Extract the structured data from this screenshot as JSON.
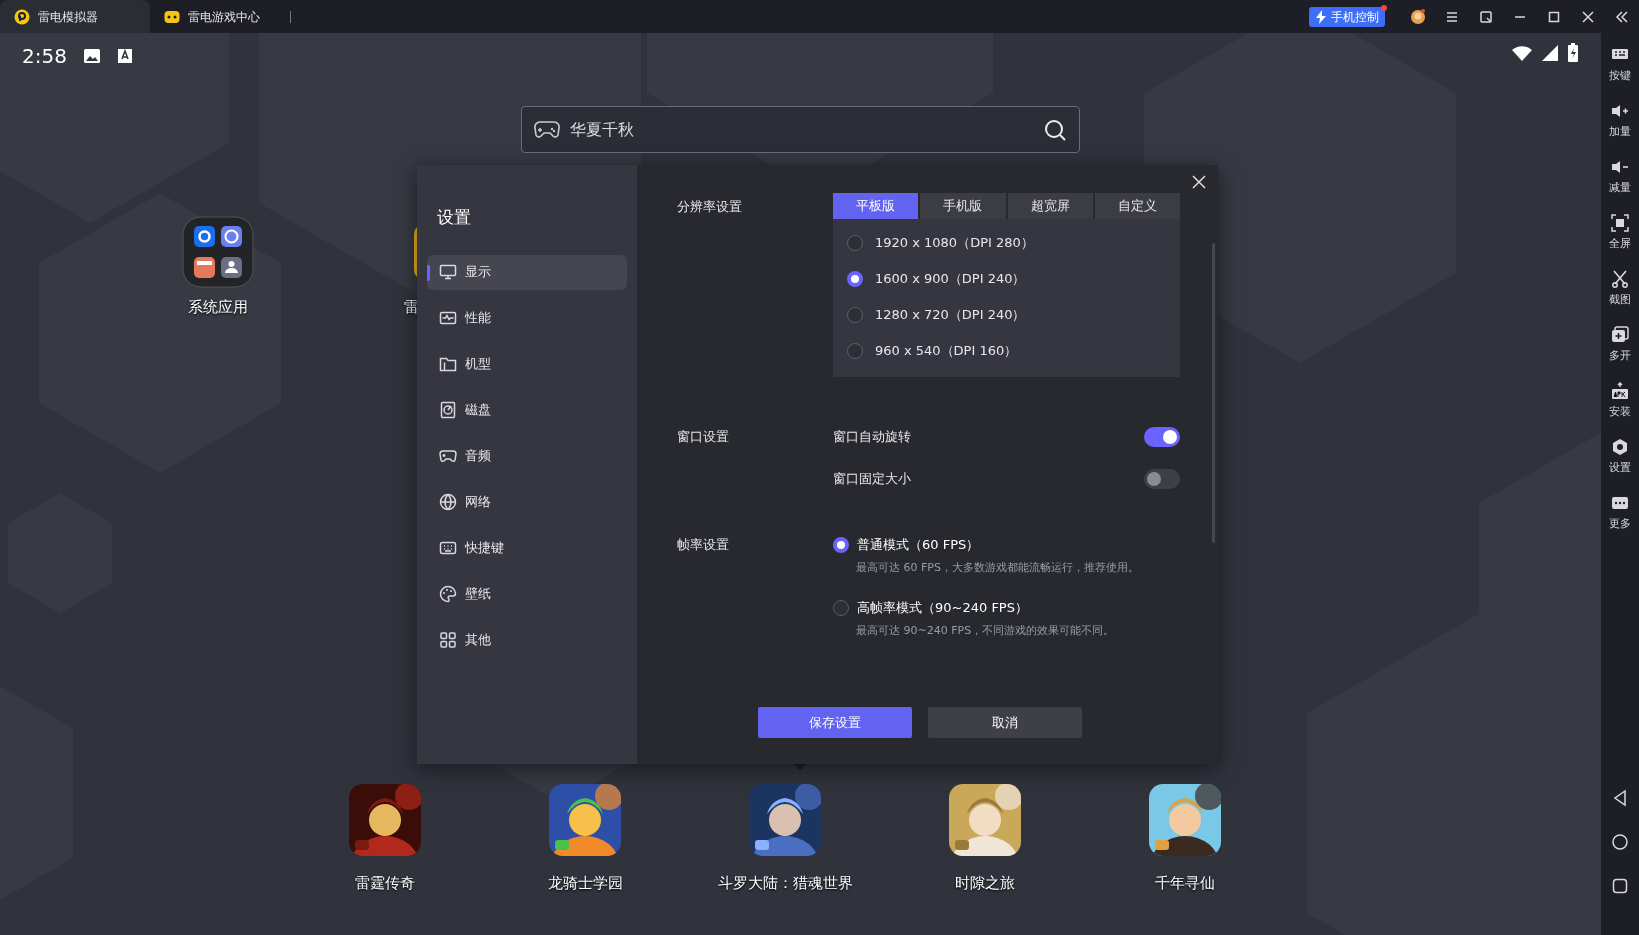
{
  "window": {
    "tabs": [
      {
        "label": "雷电模拟器",
        "selected": true
      },
      {
        "label": "雷电游戏中心",
        "selected": false
      }
    ],
    "phone_control": "手机控制"
  },
  "status_bar": {
    "time": "2:58"
  },
  "search": {
    "placeholder": "华夏千秋"
  },
  "desktop": [
    {
      "label": "系统应用"
    },
    {
      "label": "雷"
    }
  ],
  "settings": {
    "title": "设置",
    "nav": [
      {
        "label": "显示",
        "selected": true
      },
      {
        "label": "性能",
        "selected": false
      },
      {
        "label": "机型",
        "selected": false
      },
      {
        "label": "磁盘",
        "selected": false
      },
      {
        "label": "音频",
        "selected": false
      },
      {
        "label": "网络",
        "selected": false
      },
      {
        "label": "快捷键",
        "selected": false
      },
      {
        "label": "壁纸",
        "selected": false
      },
      {
        "label": "其他",
        "selected": false
      }
    ],
    "resolution": {
      "label": "分辨率设置",
      "tabs": [
        {
          "label": "平板版",
          "selected": true
        },
        {
          "label": "手机版",
          "selected": false
        },
        {
          "label": "超宽屏",
          "selected": false
        },
        {
          "label": "自定义",
          "selected": false
        }
      ],
      "options": [
        {
          "label": "1920 x 1080（DPI 280）",
          "selected": false
        },
        {
          "label": "1600 x 900（DPI 240）",
          "selected": true
        },
        {
          "label": "1280 x 720（DPI 240）",
          "selected": false
        },
        {
          "label": "960 x 540（DPI 160）",
          "selected": false
        }
      ]
    },
    "window_settings": {
      "label": "窗口设置",
      "toggles": [
        {
          "label": "窗口自动旋转",
          "on": true
        },
        {
          "label": "窗口固定大小",
          "on": false
        }
      ]
    },
    "frame_rate": {
      "label": "帧率设置",
      "options": [
        {
          "label": "普通模式（60 FPS）",
          "hint": "最高可达 60 FPS，大多数游戏都能流畅运行，推荐使用。",
          "selected": true
        },
        {
          "label": "高帧率模式（90~240 FPS）",
          "hint": "最高可达 90~240 FPS，不同游戏的效果可能不同。",
          "selected": false
        }
      ]
    },
    "buttons": {
      "save": "保存设置",
      "cancel": "取消"
    }
  },
  "dock": [
    {
      "label": "雷霆传奇"
    },
    {
      "label": "龙骑士学园"
    },
    {
      "label": "斗罗大陆：猎魂世界"
    },
    {
      "label": "时隙之旅"
    },
    {
      "label": "千年寻仙"
    }
  ],
  "sidebar": [
    {
      "label": "按键"
    },
    {
      "label": "加量"
    },
    {
      "label": "减量"
    },
    {
      "label": "全屏"
    },
    {
      "label": "截图"
    },
    {
      "label": "多开"
    },
    {
      "label": "安装"
    },
    {
      "label": "设置"
    },
    {
      "label": "更多"
    }
  ]
}
